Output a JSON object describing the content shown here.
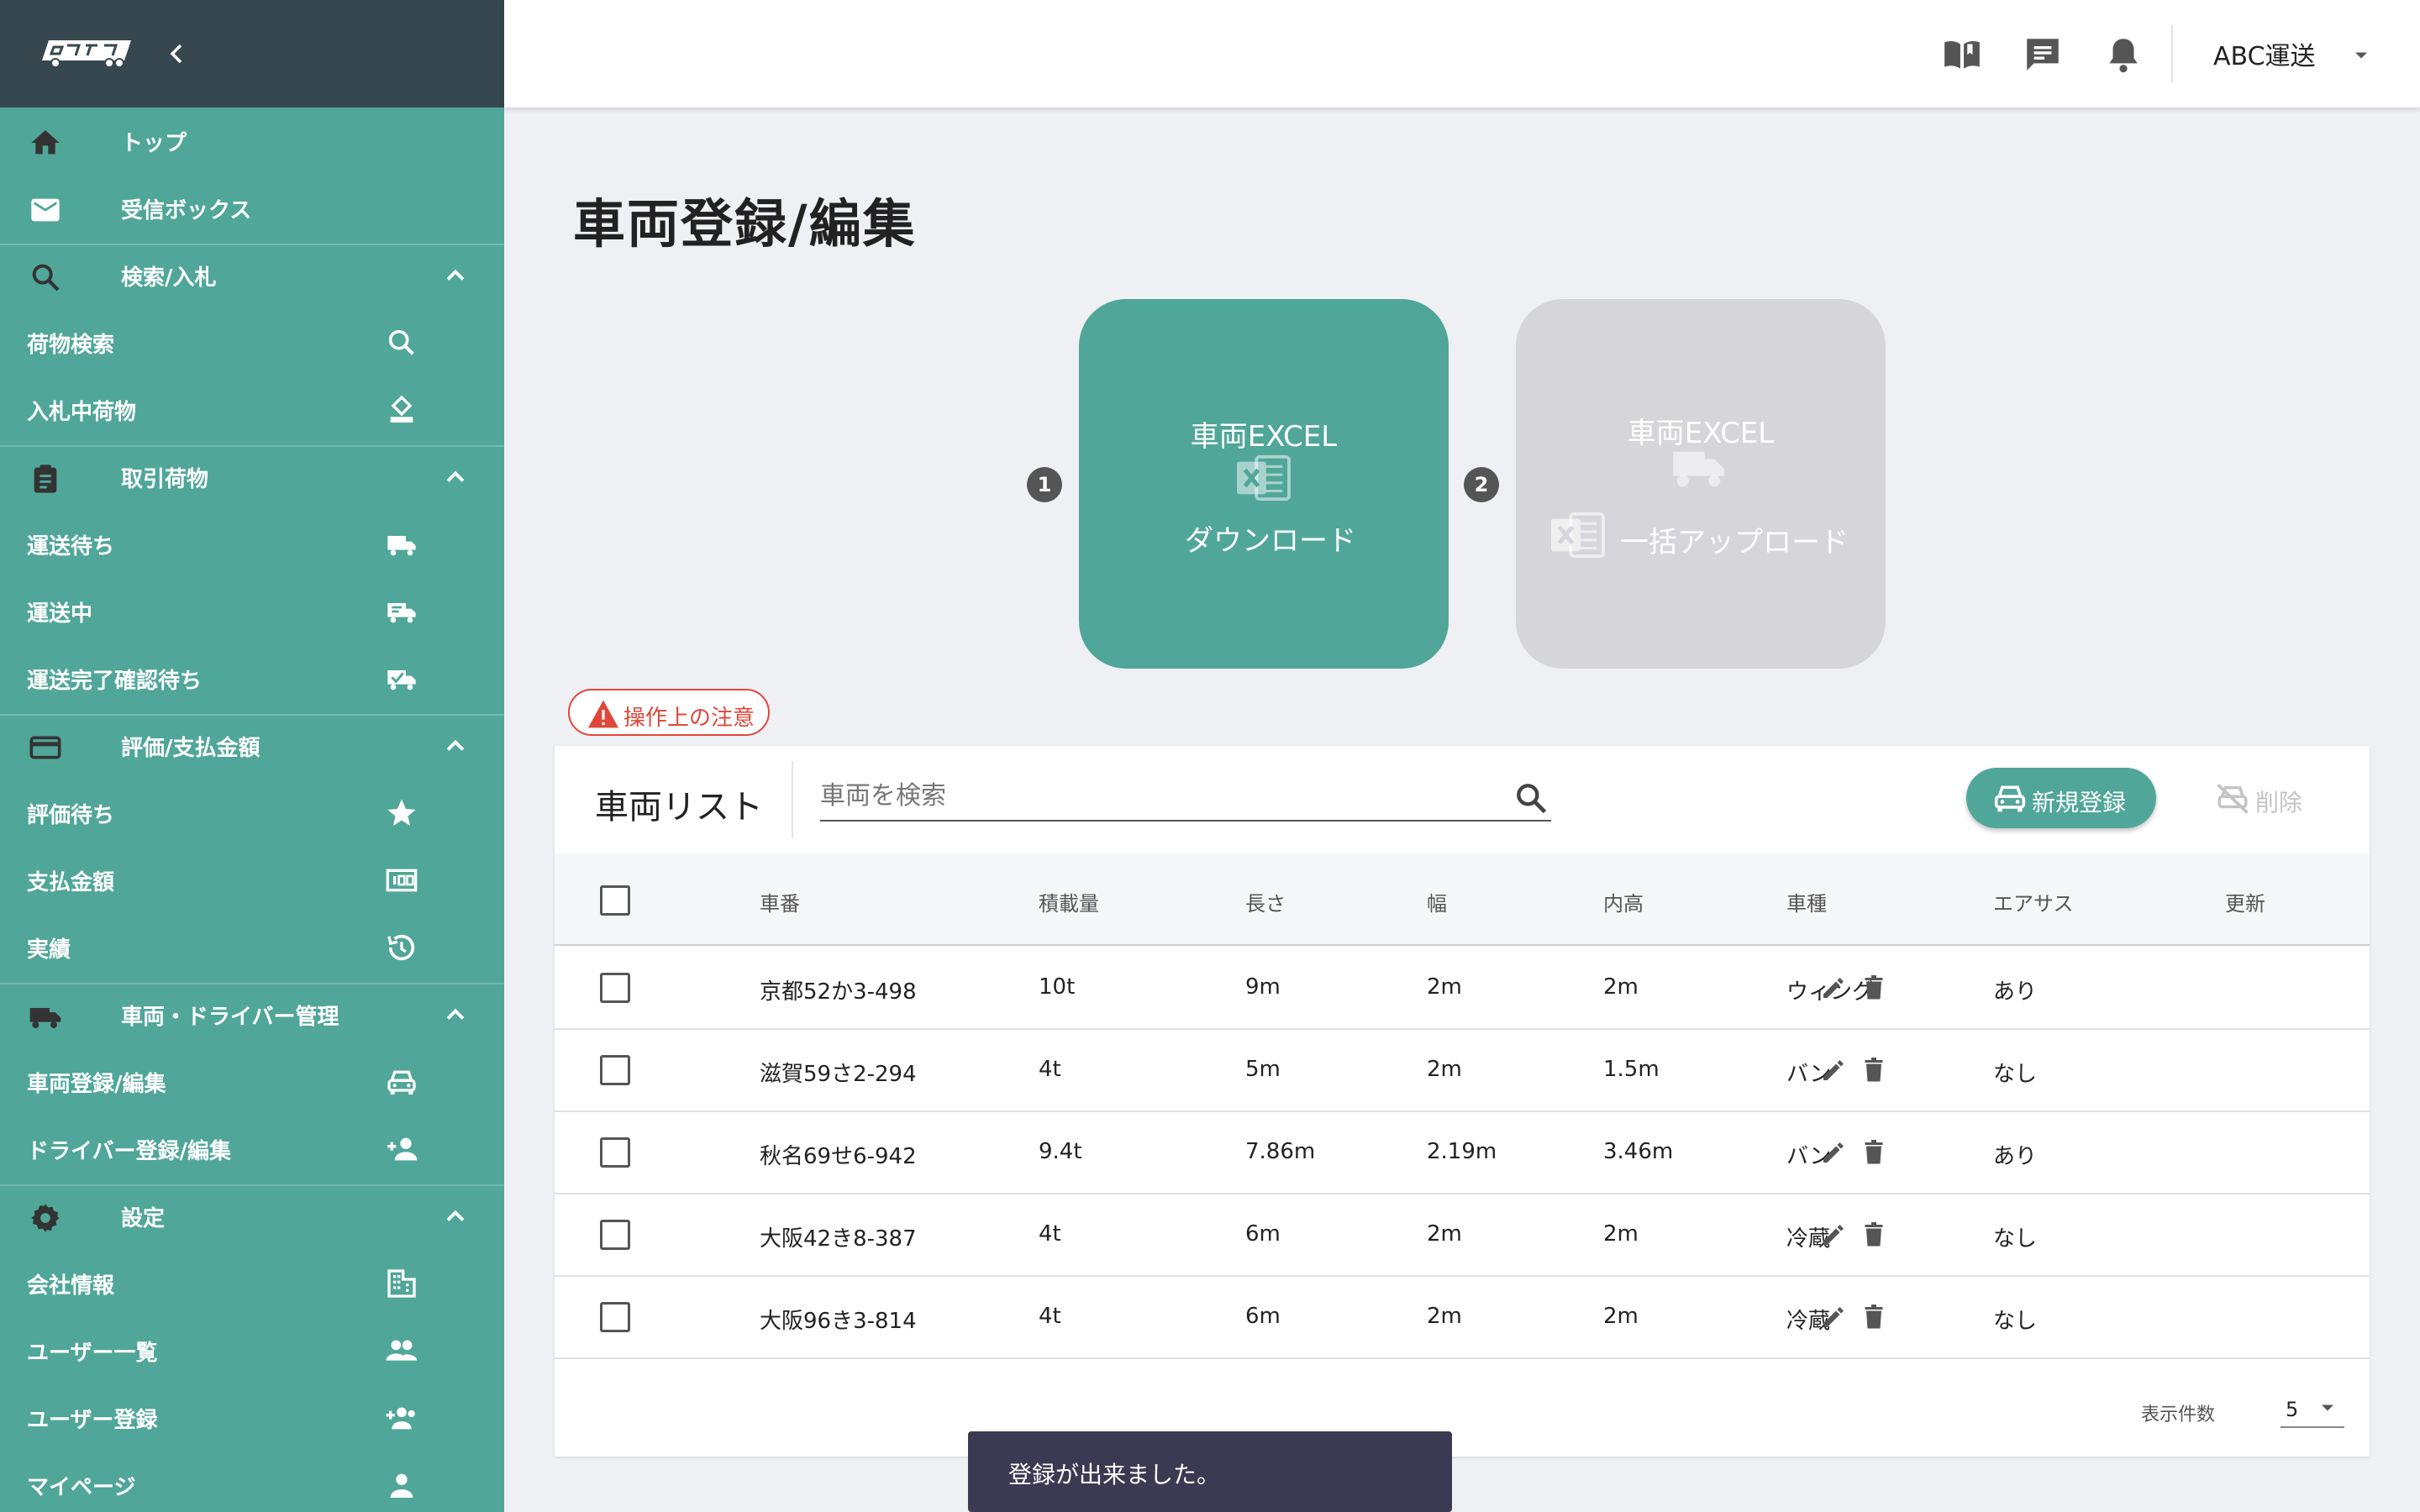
{
  "colors": {
    "accent": "#50a699",
    "sidebar_header": "#37474f",
    "warning": "#e0473a",
    "toast_bg": "#3b3a52"
  },
  "sidebar": {
    "items": [
      {
        "label": "トップ",
        "icon": "home-icon"
      },
      {
        "label": "受信ボックス",
        "icon": "mail-icon"
      },
      {
        "label": "検索/入札",
        "icon": "search-icon",
        "expanded": true
      },
      {
        "label": "荷物検索",
        "icon": "search-icon"
      },
      {
        "label": "入札中荷物",
        "icon": "bid-icon"
      },
      {
        "label": "取引荷物",
        "icon": "clipboard-icon",
        "expanded": true
      },
      {
        "label": "運送待ち",
        "icon": "truck-icon"
      },
      {
        "label": "運送中",
        "icon": "truck-moving-icon"
      },
      {
        "label": "運送完了確認待ち",
        "icon": "truck-check-icon"
      },
      {
        "label": "評価/支払金額",
        "icon": "credit-card-icon",
        "expanded": true
      },
      {
        "label": "評価待ち",
        "icon": "star-icon"
      },
      {
        "label": "支払金額",
        "icon": "money-icon"
      },
      {
        "label": "実績",
        "icon": "history-icon"
      },
      {
        "label": "車両・ドライバー管理",
        "icon": "truck-icon",
        "expanded": true
      },
      {
        "label": "車両登録/編集",
        "icon": "car-icon"
      },
      {
        "label": "ドライバー登録/編集",
        "icon": "person-add-icon"
      },
      {
        "label": "設定",
        "icon": "gear-icon",
        "expanded": true
      },
      {
        "label": "会社情報",
        "icon": "building-icon"
      },
      {
        "label": "ユーザー一覧",
        "icon": "people-icon"
      },
      {
        "label": "ユーザー登録",
        "icon": "group-add-icon"
      },
      {
        "label": "マイページ",
        "icon": "person-icon"
      }
    ]
  },
  "header": {
    "company": "ABC運送",
    "icons": [
      "manual-book-icon",
      "chat-icon",
      "bell-icon"
    ]
  },
  "main": {
    "title": "車両登録/編集",
    "steps": [
      {
        "number": "1",
        "title": "車両EXCEL",
        "subtitle": "ダウンロード",
        "enabled": true
      },
      {
        "number": "2",
        "title": "車両EXCEL",
        "subtitle": "一括アップロード",
        "enabled": false
      }
    ],
    "caution_label": "操作上の注意"
  },
  "vehicle_list": {
    "title": "車両リスト",
    "search_placeholder": "車両を検索",
    "new_button": "新規登録",
    "delete_button": "削除",
    "columns": [
      "車番",
      "積載量",
      "長さ",
      "幅",
      "内高",
      "車種",
      "エアサス",
      "更新"
    ],
    "rows": [
      {
        "number": "京都52か3-498",
        "capacity": "10t",
        "length": "9m",
        "width": "2m",
        "height": "2m",
        "type": "ウィング",
        "air_suspension": "あり"
      },
      {
        "number": "滋賀59さ2-294",
        "capacity": "4t",
        "length": "5m",
        "width": "2m",
        "height": "1.5m",
        "type": "バン",
        "air_suspension": "なし"
      },
      {
        "number": "秋名69せ6-942",
        "capacity": "9.4t",
        "length": "7.86m",
        "width": "2.19m",
        "height": "3.46m",
        "type": "バン",
        "air_suspension": "あり"
      },
      {
        "number": "大阪42き8-387",
        "capacity": "4t",
        "length": "6m",
        "width": "2m",
        "height": "2m",
        "type": "冷蔵",
        "air_suspension": "なし"
      },
      {
        "number": "大阪96き3-814",
        "capacity": "4t",
        "length": "6m",
        "width": "2m",
        "height": "2m",
        "type": "冷蔵",
        "air_suspension": "なし"
      }
    ],
    "rows_per_page_label": "表示件数",
    "rows_per_page": "5"
  },
  "toast": {
    "message": "登録が出来ました。"
  }
}
